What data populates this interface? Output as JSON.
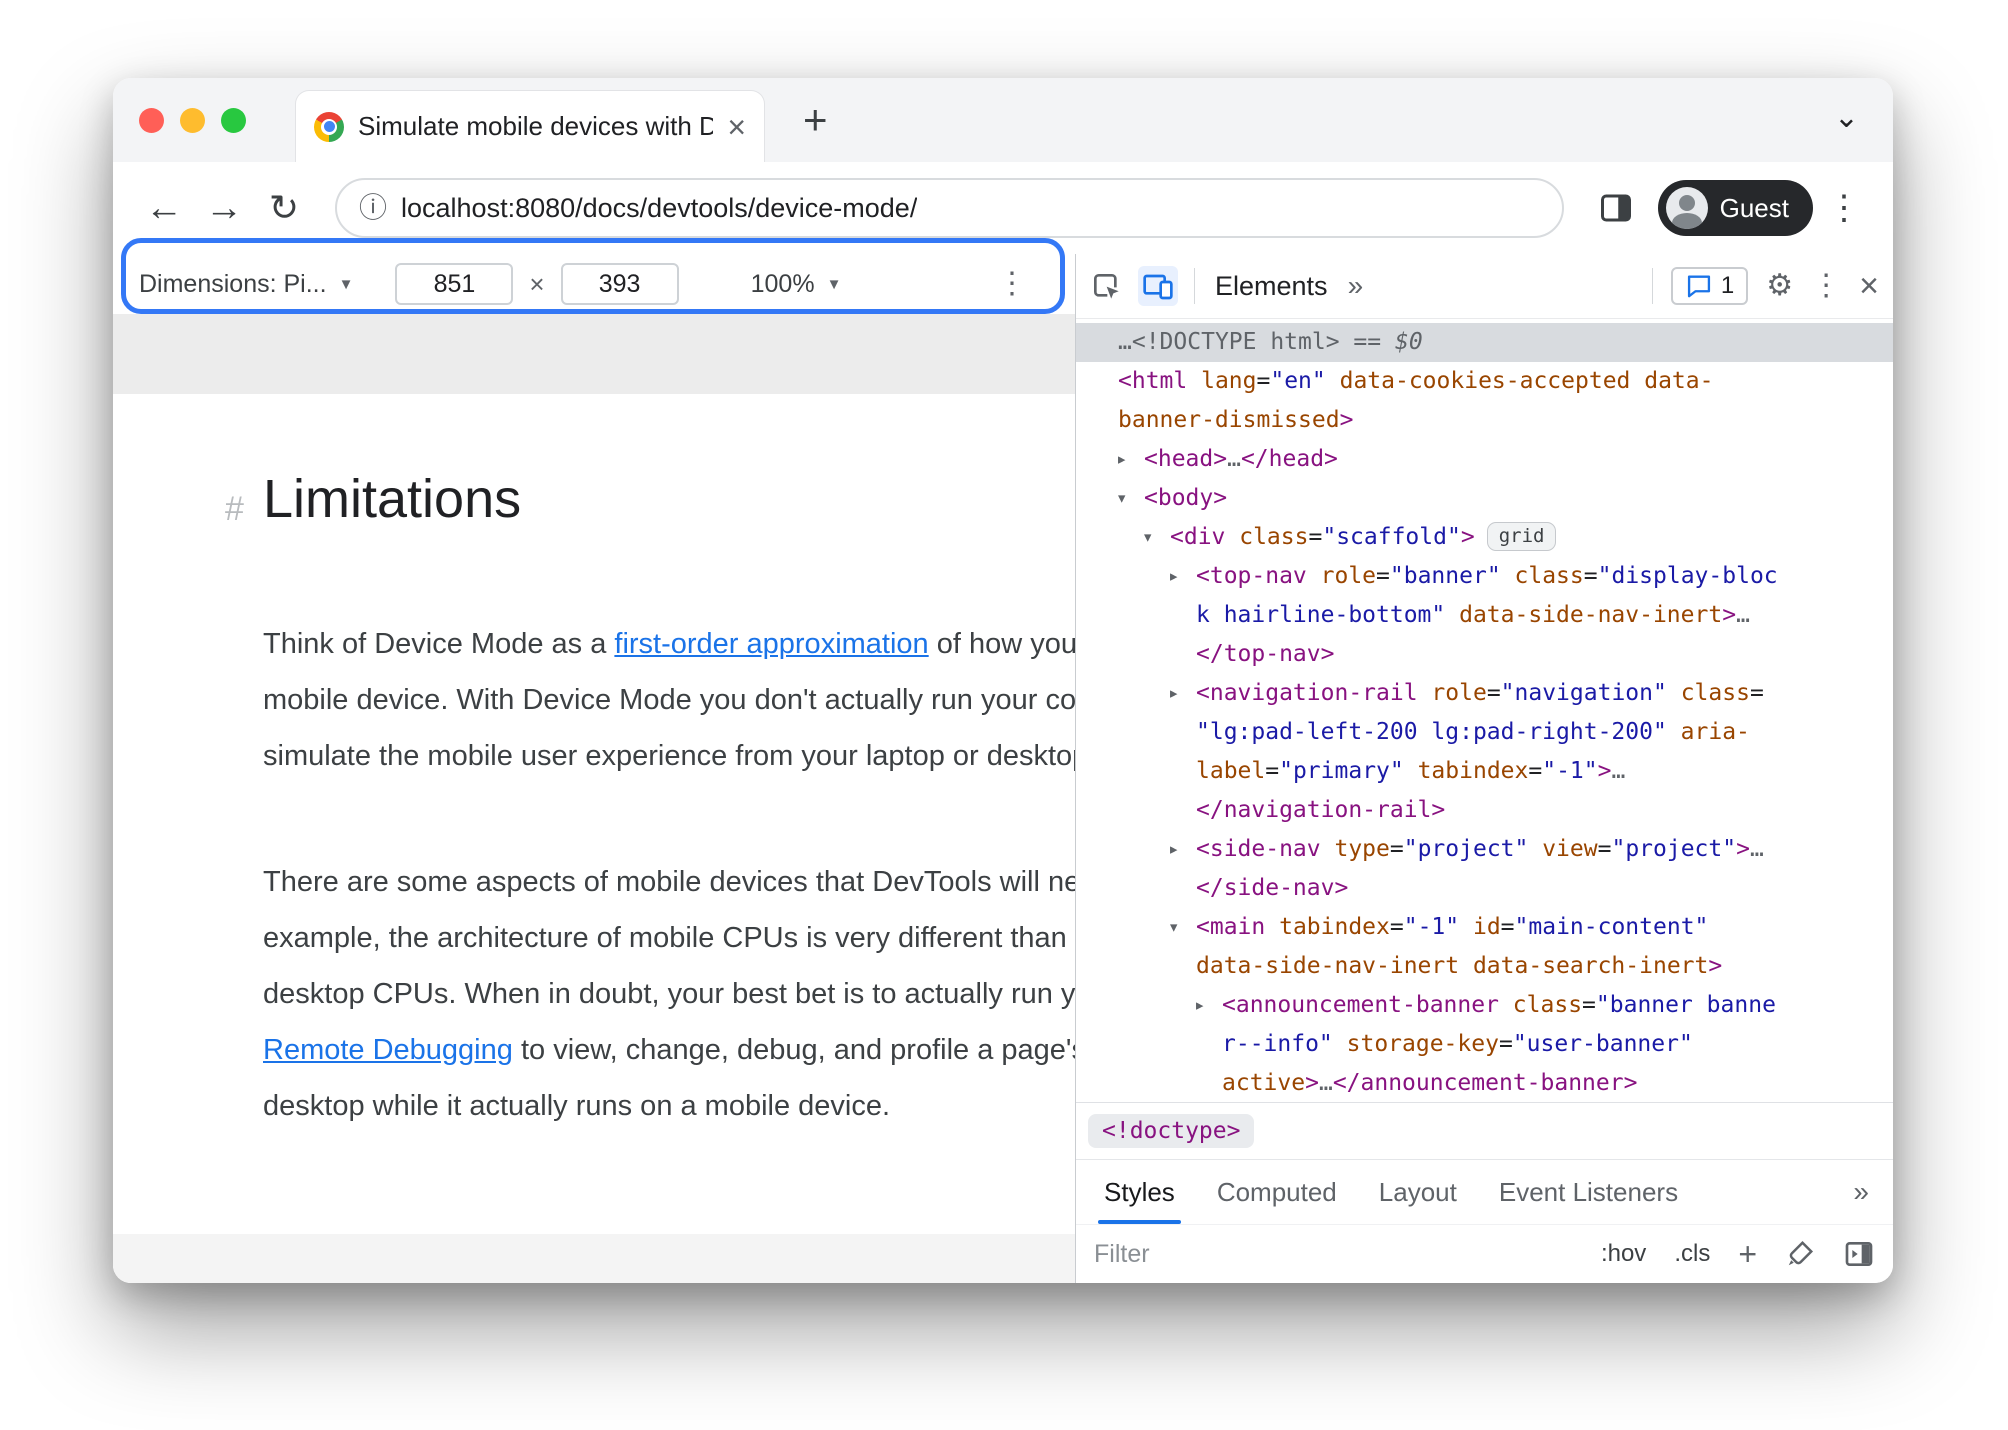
{
  "colors": {
    "accent_blue": "#1a73e8",
    "highlight_ring": "#3478f6",
    "token_tag": "#881280",
    "token_attr": "#994500",
    "token_value": "#1a1aa6"
  },
  "browser": {
    "tab_title": "Simulate mobile devices with D",
    "url": "localhost:8080/docs/devtools/device-mode/",
    "profile_label": "Guest"
  },
  "device_toolbar": {
    "dimensions": "Dimensions: Pi...",
    "width": "851",
    "times": "×",
    "height": "393",
    "zoom": "100%"
  },
  "page": {
    "hash": "#",
    "heading": "Limitations",
    "paragraphs": [
      [
        [
          {
            "t": "text",
            "s": "Think of Device Mode as a "
          },
          {
            "t": "link",
            "s": "first-order approximation"
          },
          {
            "t": "text",
            "s": " of how your"
          }
        ],
        [
          {
            "t": "text",
            "s": "mobile device. With Device Mode you don't actually run your code"
          }
        ],
        [
          {
            "t": "text",
            "s": "simulate the mobile user experience from your laptop or desktop."
          }
        ]
      ],
      [
        [
          {
            "t": "text",
            "s": "There are some aspects of mobile devices that DevTools will never"
          }
        ],
        [
          {
            "t": "text",
            "s": "example, the architecture of mobile CPUs is very different than the"
          }
        ],
        [
          {
            "t": "text",
            "s": "desktop CPUs. When in doubt, your best bet is to actually run your"
          }
        ],
        [
          {
            "t": "link",
            "s": "Remote Debugging"
          },
          {
            "t": "text",
            "s": " to view, change, debug, and profile a page's"
          }
        ],
        [
          {
            "t": "text",
            "s": "desktop while it actually runs on a mobile device."
          }
        ]
      ]
    ]
  },
  "devtools": {
    "panel_tab": "Elements",
    "more": "»",
    "issues_count": "1",
    "breadcrumb": "<!doctype>",
    "sidebar_tabs": [
      "Styles",
      "Computed",
      "Layout",
      "Event Listeners"
    ],
    "filter_placeholder": "Filter",
    "hov": ":hov",
    "cls": ".cls",
    "plus": "+",
    "tree": [
      {
        "i": 0,
        "sel": true,
        "seg": [
          [
            "g",
            "…"
          ],
          [
            "g",
            "<!DOCTYPE html>"
          ],
          [
            "g",
            " == "
          ],
          [
            "gi",
            "$0"
          ]
        ]
      },
      {
        "i": 0,
        "seg": [
          [
            "t",
            "<html"
          ],
          [
            "a",
            " lang"
          ],
          [
            "p",
            "="
          ],
          [
            "v",
            "\"en\""
          ],
          [
            "a",
            " data-cookies-accepted"
          ],
          [
            "a",
            " data-"
          ]
        ]
      },
      {
        "i": 0,
        "seg": [
          [
            "a",
            "banner-dismissed"
          ],
          [
            "t",
            ">"
          ]
        ]
      },
      {
        "i": 1,
        "ar": "r",
        "seg": [
          [
            "t",
            "<head>"
          ],
          [
            "g",
            "…"
          ],
          [
            "t",
            "</head>"
          ]
        ]
      },
      {
        "i": 1,
        "ar": "d",
        "seg": [
          [
            "t",
            "<body>"
          ]
        ]
      },
      {
        "i": 2,
        "ar": "d",
        "badge": "grid",
        "seg": [
          [
            "t",
            "<div"
          ],
          [
            "a",
            " class"
          ],
          [
            "p",
            "="
          ],
          [
            "v",
            "\"scaffold\""
          ],
          [
            "t",
            ">"
          ]
        ]
      },
      {
        "i": 3,
        "ar": "r",
        "seg": [
          [
            "t",
            "<top-nav"
          ],
          [
            "a",
            " role"
          ],
          [
            "p",
            "="
          ],
          [
            "v",
            "\"banner\""
          ],
          [
            "a",
            " class"
          ],
          [
            "p",
            "="
          ],
          [
            "v",
            "\"display-bloc"
          ]
        ]
      },
      {
        "i": 3,
        "seg": [
          [
            "v",
            "k hairline-bottom\""
          ],
          [
            "a",
            " data-side-nav-inert"
          ],
          [
            "t",
            ">"
          ],
          [
            "g",
            "…"
          ]
        ]
      },
      {
        "i": 3,
        "seg": [
          [
            "t",
            "</top-nav>"
          ]
        ]
      },
      {
        "i": 3,
        "ar": "r",
        "seg": [
          [
            "t",
            "<navigation-rail"
          ],
          [
            "a",
            " role"
          ],
          [
            "p",
            "="
          ],
          [
            "v",
            "\"navigation\""
          ],
          [
            "a",
            " class"
          ],
          [
            "p",
            "="
          ]
        ]
      },
      {
        "i": 3,
        "seg": [
          [
            "v",
            "\"lg:pad-left-200 lg:pad-right-200\""
          ],
          [
            "a",
            " aria-"
          ]
        ]
      },
      {
        "i": 3,
        "seg": [
          [
            "a",
            "label"
          ],
          [
            "p",
            "="
          ],
          [
            "v",
            "\"primary\""
          ],
          [
            "a",
            " tabindex"
          ],
          [
            "p",
            "="
          ],
          [
            "v",
            "\"-1\""
          ],
          [
            "t",
            ">"
          ],
          [
            "g",
            "…"
          ]
        ]
      },
      {
        "i": 3,
        "seg": [
          [
            "t",
            "</navigation-rail>"
          ]
        ]
      },
      {
        "i": 3,
        "ar": "r",
        "seg": [
          [
            "t",
            "<side-nav"
          ],
          [
            "a",
            " type"
          ],
          [
            "p",
            "="
          ],
          [
            "v",
            "\"project\""
          ],
          [
            "a",
            " view"
          ],
          [
            "p",
            "="
          ],
          [
            "v",
            "\"project\""
          ],
          [
            "t",
            ">"
          ],
          [
            "g",
            "…"
          ]
        ]
      },
      {
        "i": 3,
        "seg": [
          [
            "t",
            "</side-nav>"
          ]
        ]
      },
      {
        "i": 3,
        "ar": "d",
        "seg": [
          [
            "t",
            "<main"
          ],
          [
            "a",
            " tabindex"
          ],
          [
            "p",
            "="
          ],
          [
            "v",
            "\"-1\""
          ],
          [
            "a",
            " id"
          ],
          [
            "p",
            "="
          ],
          [
            "v",
            "\"main-content\""
          ]
        ]
      },
      {
        "i": 3,
        "seg": [
          [
            "a",
            "data-side-nav-inert"
          ],
          [
            "a",
            " data-search-inert"
          ],
          [
            "t",
            ">"
          ]
        ]
      },
      {
        "i": 4,
        "ar": "r",
        "seg": [
          [
            "t",
            "<announcement-banner"
          ],
          [
            "a",
            " class"
          ],
          [
            "p",
            "="
          ],
          [
            "v",
            "\"banner banne"
          ]
        ]
      },
      {
        "i": 4,
        "seg": [
          [
            "v",
            "r--info\""
          ],
          [
            "a",
            " storage-key"
          ],
          [
            "p",
            "="
          ],
          [
            "v",
            "\"user-banner\""
          ]
        ]
      },
      {
        "i": 4,
        "seg": [
          [
            "a",
            "active"
          ],
          [
            "t",
            ">"
          ],
          [
            "g",
            "…"
          ],
          [
            "t",
            "</announcement-banner>"
          ]
        ]
      }
    ]
  }
}
